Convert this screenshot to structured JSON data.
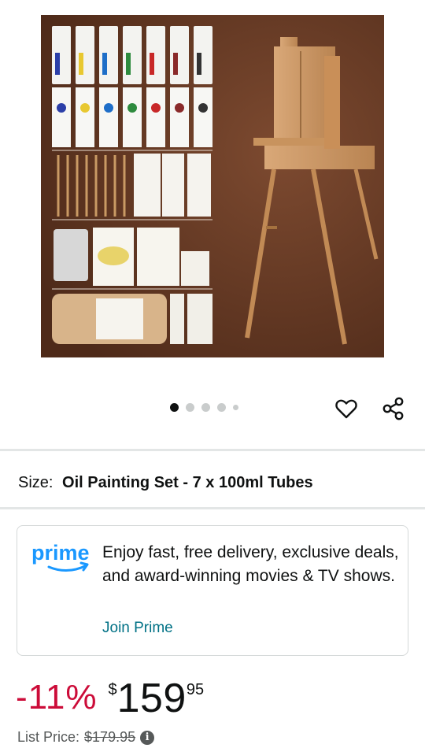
{
  "product": {
    "image_alt": "Oil painting set with French easel",
    "carousel": {
      "count": 5,
      "active_index": 0
    }
  },
  "icons": {
    "heart": "heart-icon",
    "share": "share-icon",
    "info": "info-icon"
  },
  "size": {
    "label": "Size:",
    "value": "Oil Painting Set - 7 x 100ml Tubes"
  },
  "prime": {
    "logo_text": "prime",
    "message": "Enjoy fast, free delivery, exclusive deals, and award-winning movies & TV shows.",
    "link_label": "Join Prime"
  },
  "pricing": {
    "discount": "-11%",
    "currency_symbol": "$",
    "price_whole": "159",
    "price_fraction": "95",
    "list_price_label": "List Price:",
    "list_price": "$179.95"
  },
  "colors": {
    "discount_red": "#cc0c39",
    "link_teal": "#007185",
    "prime_blue": "#1a98ff",
    "image_background": "#6a3a24"
  }
}
